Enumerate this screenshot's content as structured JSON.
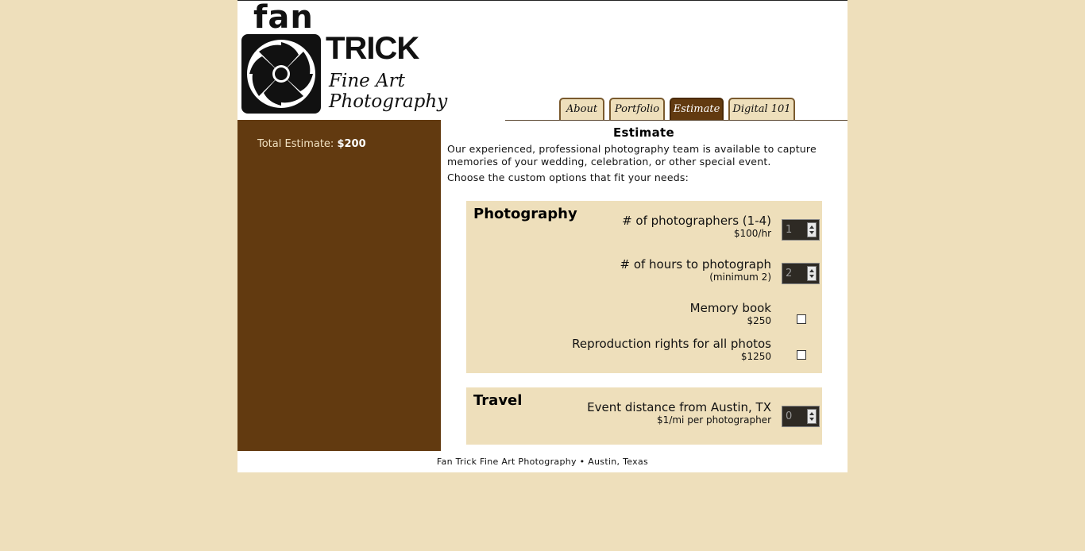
{
  "logo": {
    "line1": "fan",
    "line2": "TRICK",
    "line3": "Fine Art Photography"
  },
  "nav": {
    "tabs": [
      {
        "label": "About"
      },
      {
        "label": "Portfolio"
      },
      {
        "label": "Estimate",
        "active": true
      },
      {
        "label": "Digital 101"
      }
    ]
  },
  "sidebar": {
    "total_label": "Total Estimate:",
    "total_value": "$200"
  },
  "main": {
    "title": "Estimate",
    "intro1": "Our experienced, professional photography team is available to capture memories of your wedding, celebration, or other special event.",
    "intro2": "Choose the custom options that fit your needs:",
    "photography": {
      "heading": "Photography",
      "options": [
        {
          "label": "# of photographers (1-4)",
          "sub": "$100/hr",
          "value": "1"
        },
        {
          "label": "# of hours to photograph",
          "sub": "(minimum 2)",
          "value": "2"
        },
        {
          "label": "Memory book",
          "sub": "$250",
          "checked": false
        },
        {
          "label": "Reproduction rights for all photos",
          "sub": "$1250",
          "checked": false
        }
      ]
    },
    "travel": {
      "heading": "Travel",
      "options": [
        {
          "label": "Event distance from Austin, TX",
          "sub": "$1/mi per photographer",
          "value": "0"
        }
      ]
    }
  },
  "footer": {
    "text": "Fan Trick Fine Art Photography • Austin, Texas"
  },
  "colors": {
    "background": "#eedfbb",
    "sidebar": "#623a10",
    "active_tab": "#623a10"
  }
}
